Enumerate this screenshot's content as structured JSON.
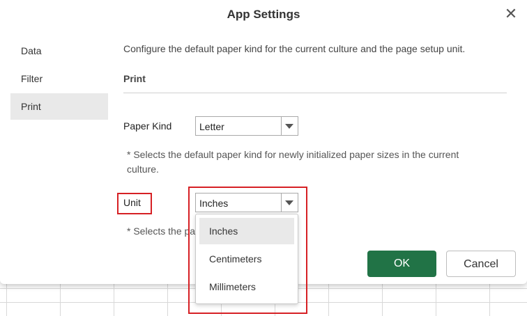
{
  "dialog": {
    "title": "App Settings",
    "close_glyph": "✕"
  },
  "nav": {
    "items": [
      {
        "label": "Data"
      },
      {
        "label": "Filter"
      },
      {
        "label": "Print"
      }
    ],
    "active": "Print"
  },
  "main": {
    "description": "Configure the default paper kind for the current culture and the page setup unit.",
    "section_title": "Print",
    "paper_kind": {
      "label": "Paper Kind",
      "value": "Letter",
      "note_line1": "* Selects the default paper kind for newly initialized paper sizes in the current",
      "note_line2": "culture."
    },
    "unit": {
      "label": "Unit",
      "value": "Inches",
      "note": "* Selects the pa",
      "options": [
        "Inches",
        "Centimeters",
        "Millimeters"
      ],
      "selected_option": "Inches"
    }
  },
  "buttons": {
    "ok": "OK",
    "cancel": "Cancel"
  },
  "colors": {
    "ok_button": "#217346",
    "highlight": "#d62024",
    "selected_bg": "#e9e9e9"
  },
  "icons": {
    "close": "close-icon",
    "dropdown_arrow": "chevron-down-icon"
  }
}
